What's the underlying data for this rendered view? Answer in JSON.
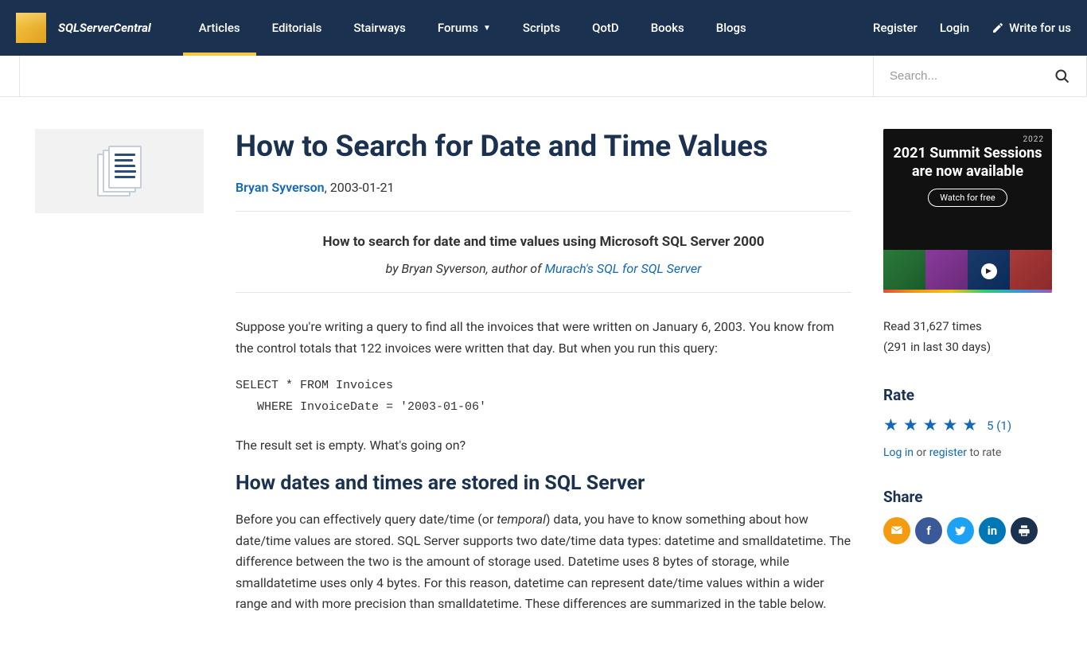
{
  "brand": "SQLServerCentral",
  "nav": {
    "items": [
      "Articles",
      "Editorials",
      "Stairways",
      "Forums",
      "Scripts",
      "QotD",
      "Books",
      "Blogs"
    ],
    "activeIndex": 0,
    "dropdownIndex": 3,
    "register": "Register",
    "login": "Login",
    "write": "Write for us"
  },
  "search": {
    "placeholder": "Search..."
  },
  "article": {
    "title": "How to Search for Date and Time Values",
    "author": "Bryan Syverson",
    "date": "2003-01-21",
    "subhead": "How to search for date and time values using Microsoft SQL Server 2000",
    "byline_prefix": "by Bryan Syverson, author of ",
    "byline_link": "Murach's SQL for SQL Server",
    "p1": "Suppose you're writing a query to find all the invoices that were written on January 6, 2003. You know from the control totals that 122 invoices were written that day. But when you run this query:",
    "code": "SELECT * FROM Invoices\n   WHERE InvoiceDate = '2003-01-06'",
    "p2": "The result set is empty. What's going on?",
    "h2": "How dates and times are stored in SQL Server",
    "p3a": "Before you can effectively query date/time (or ",
    "p3_em": "temporal",
    "p3b": ") data, you have to know something about how date/time values are stored. SQL Server supports two date/time data types: datetime and smalldatetime. The difference between the two is the amount of storage used. Datetime uses 8 bytes of storage, while smalldatetime uses only 4 bytes. For this reason, datetime can represent date/time values within a wider range and with more precision than smalldatetime. These differences are summarized in the table below."
  },
  "promo": {
    "heading": "2021 Summit Sessions are now available",
    "button": "Watch for free",
    "badge": "2022"
  },
  "sidebar": {
    "read_line1": "Read 31,627 times",
    "read_line2": "(291 in last 30 days)",
    "rate_head": "Rate",
    "rate_value": "5 (1)",
    "login_text": "Log in",
    "or_text": " or ",
    "register_text": "register",
    "to_rate": " to rate",
    "share_head": "Share"
  }
}
